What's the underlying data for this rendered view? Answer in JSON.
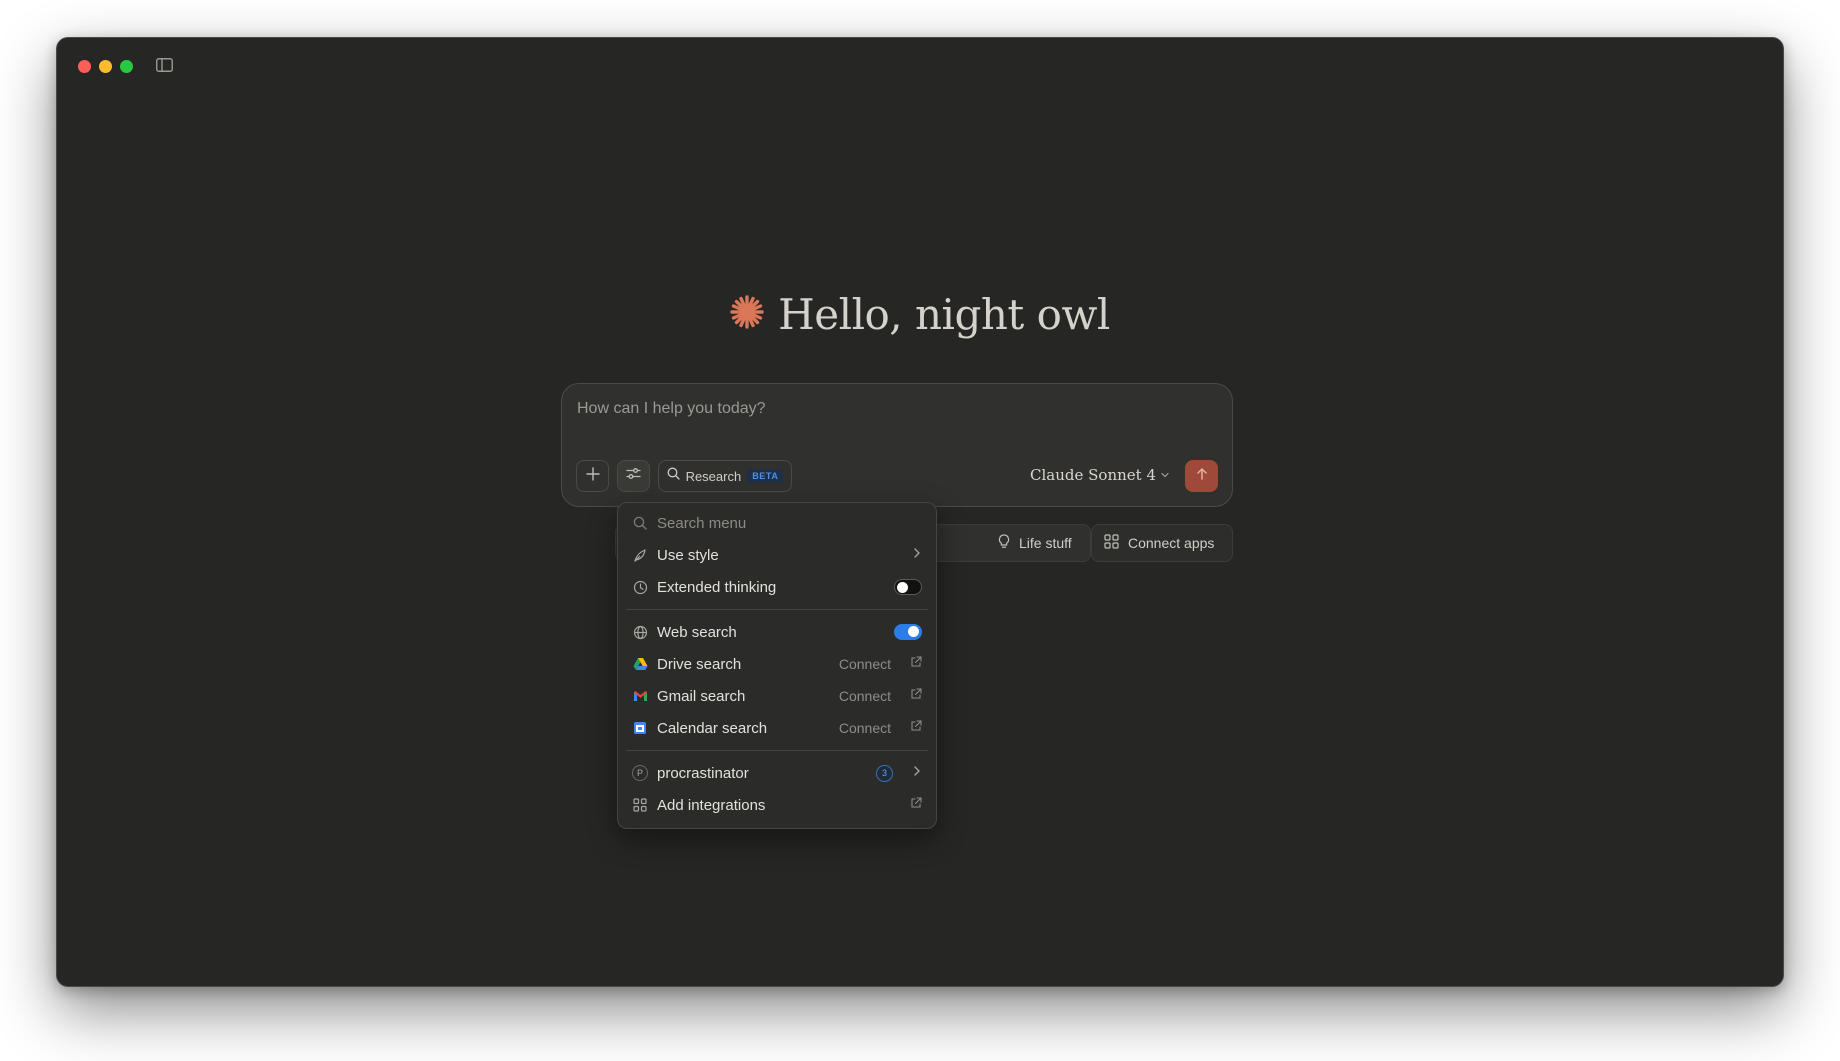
{
  "greeting": {
    "text": "Hello, night owl",
    "icon": "claude-spark-icon",
    "accent_color": "#d97757"
  },
  "composer": {
    "placeholder": "How can I help you today?",
    "research_label": "Research",
    "beta_label": "BETA",
    "model_label": "Claude Sonnet 4",
    "send_color": "#9f4a38"
  },
  "chips": {
    "life_stuff": "Life stuff",
    "connect_apps": "Connect apps"
  },
  "menu": {
    "search_placeholder": "Search menu",
    "use_style": "Use style",
    "extended_thinking": "Extended thinking",
    "extended_thinking_on": false,
    "web_search": "Web search",
    "web_search_on": true,
    "drive_search": "Drive search",
    "gmail_search": "Gmail search",
    "calendar_search": "Calendar search",
    "connect_label": "Connect",
    "project_name": "procrastinator",
    "project_initial": "P",
    "project_count": "3",
    "add_integrations": "Add integrations"
  }
}
